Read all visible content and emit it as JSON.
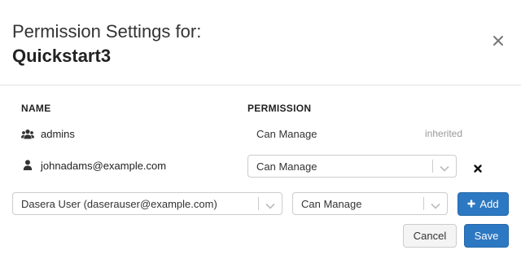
{
  "header": {
    "subtitle": "Permission Settings for:",
    "title": "Quickstart3",
    "close_icon": "close-icon"
  },
  "table": {
    "columns": {
      "name": "NAME",
      "permission": "PERMISSION"
    },
    "rows": [
      {
        "icon": "group-icon",
        "name": "admins",
        "permission": "Can Manage",
        "note": "inherited"
      },
      {
        "icon": "user-icon",
        "name": "johnadams@example.com",
        "permission": "Can Manage",
        "remove_icon": "remove-icon"
      }
    ]
  },
  "add_form": {
    "user_select": "Dasera User (daserauser@example.com)",
    "permission_select": "Can Manage",
    "add_label": "Add"
  },
  "footer": {
    "cancel_label": "Cancel",
    "save_label": "Save"
  },
  "colors": {
    "primary": "#2c78c2",
    "muted_text": "#999999"
  }
}
